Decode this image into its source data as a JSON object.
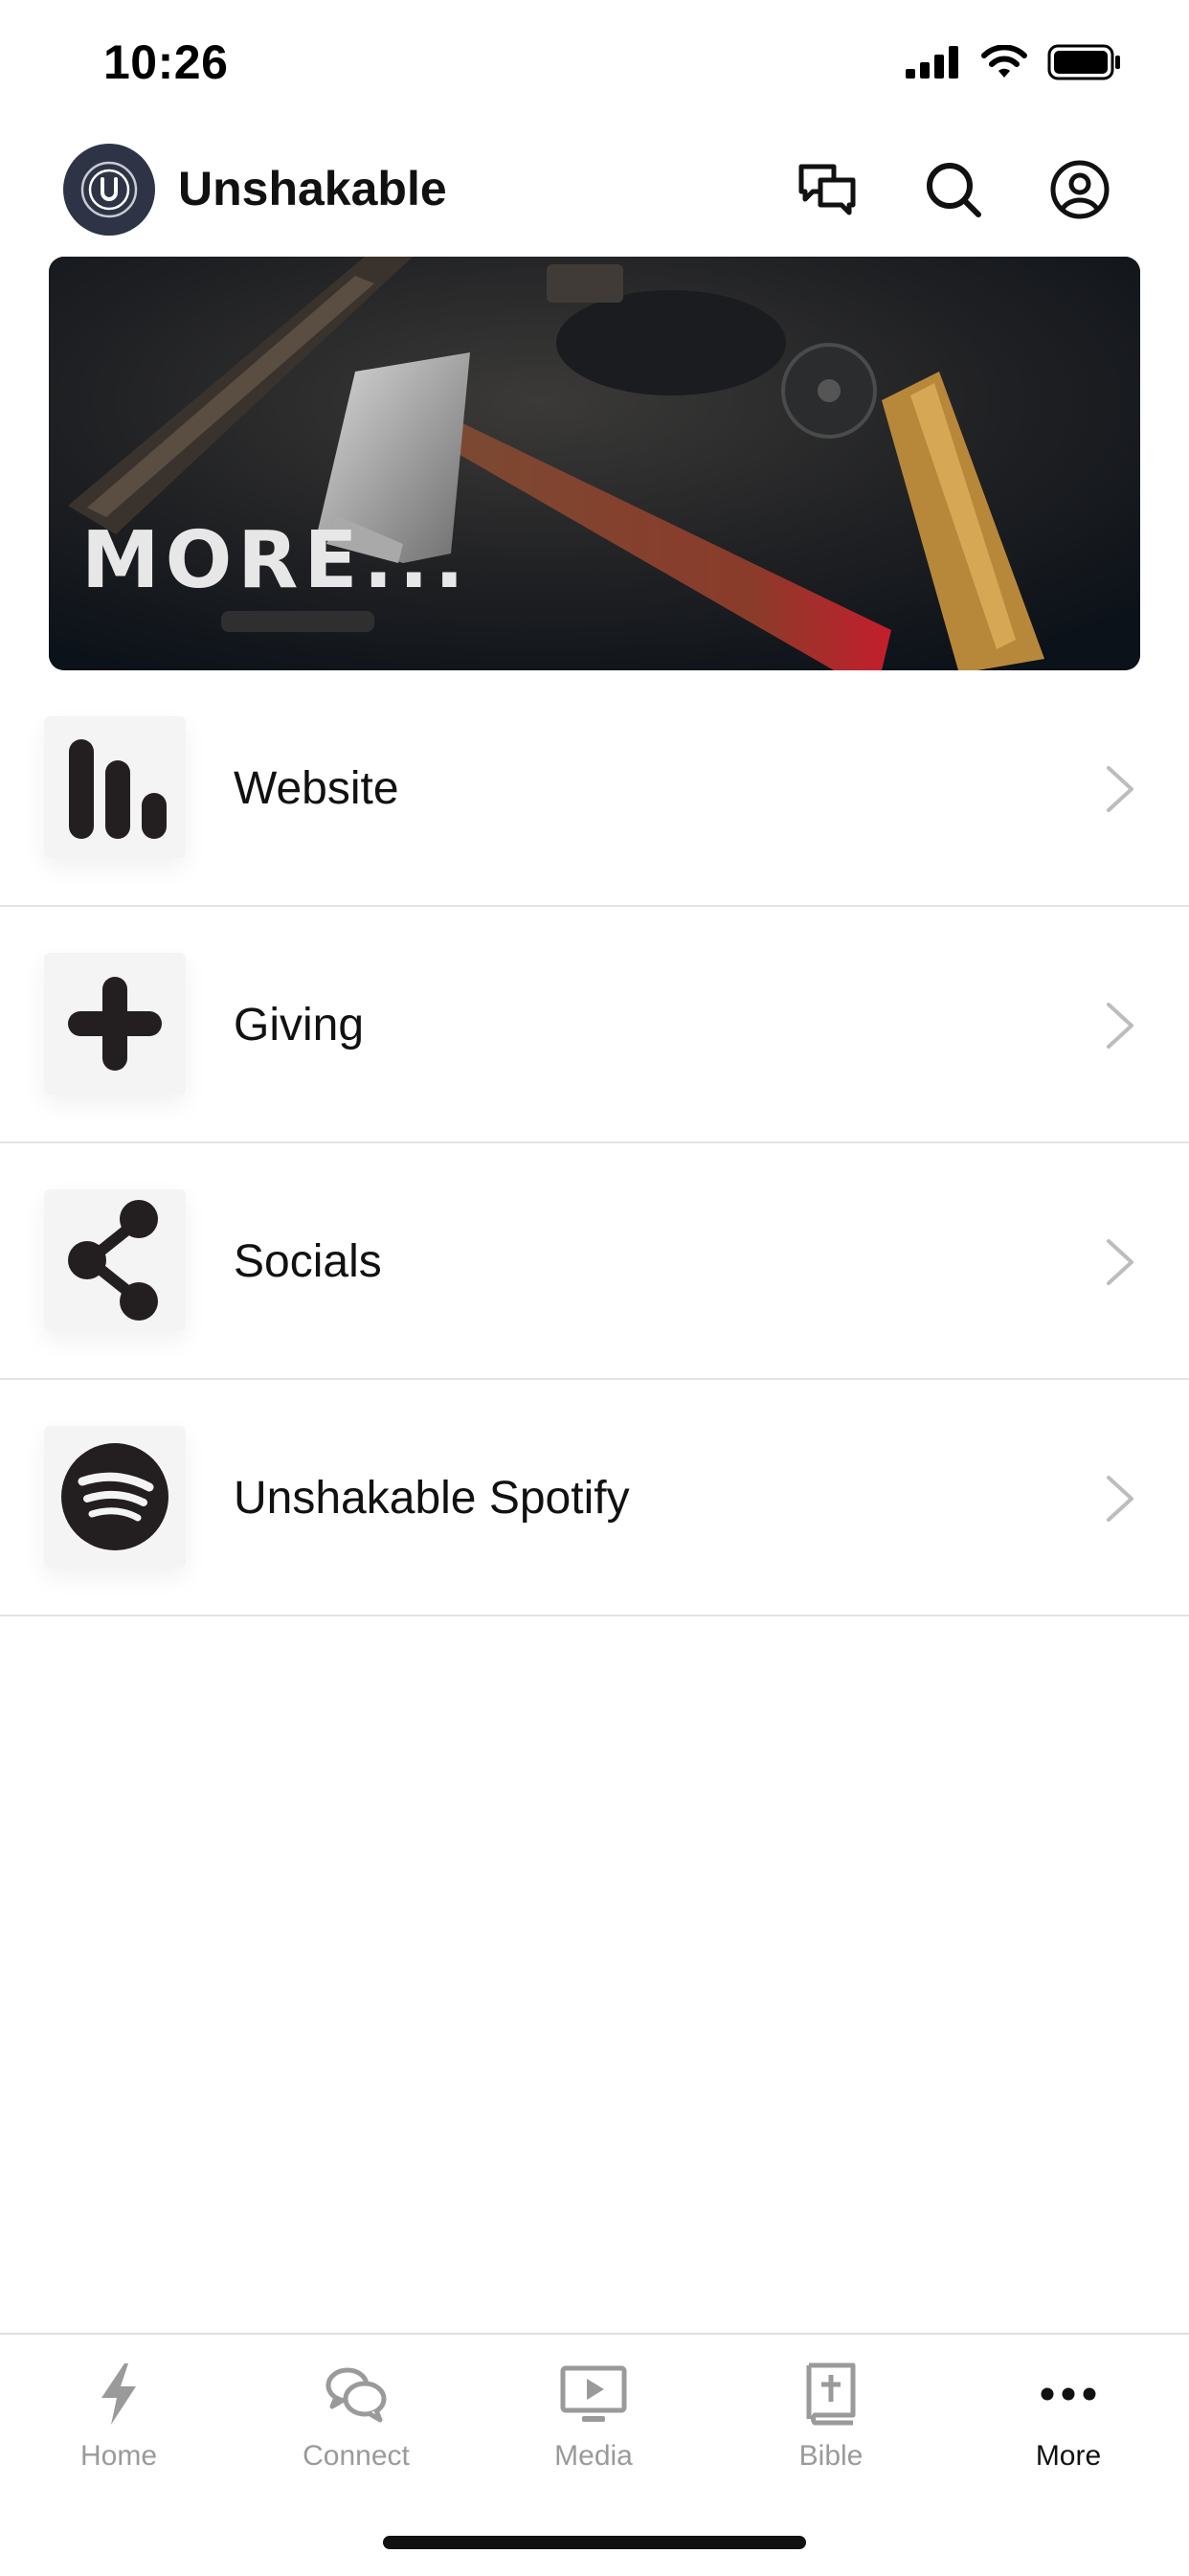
{
  "status_bar": {
    "time": "10:26"
  },
  "header": {
    "title": "Unshakable",
    "logo_letter": "U"
  },
  "banner": {
    "text": "MORE..."
  },
  "menu": [
    {
      "label": "Website",
      "icon": "bars-chart-icon"
    },
    {
      "label": "Giving",
      "icon": "plus-icon"
    },
    {
      "label": "Socials",
      "icon": "share-icon"
    },
    {
      "label": "Unshakable Spotify",
      "icon": "spotify-icon"
    }
  ],
  "tabs": [
    {
      "label": "Home",
      "icon": "lightning-icon"
    },
    {
      "label": "Connect",
      "icon": "chat-bubbles-icon"
    },
    {
      "label": "Media",
      "icon": "play-screen-icon"
    },
    {
      "label": "Bible",
      "icon": "bible-icon"
    },
    {
      "label": "More",
      "icon": "ellipsis-icon",
      "active": true
    }
  ],
  "colors": {
    "accent": "#111111",
    "inactive_tab": "#9a9a9a",
    "logo_bg": "#2e3446",
    "divider": "#e3e3e3"
  }
}
